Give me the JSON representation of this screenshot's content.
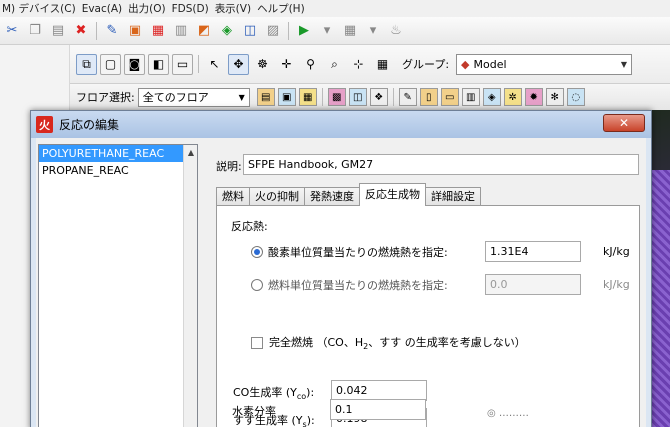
{
  "menubar": {
    "items": [
      "M) デバイス(C)",
      "Evac(A)",
      "出力(O)",
      "FDS(D)",
      "表示(V)",
      "ヘルプ(H)"
    ]
  },
  "toolbar2": {
    "group_label": "グループ:",
    "group_value": "Model"
  },
  "toolbar3": {
    "floor_label": "フロア選択:",
    "floor_value": "全てのフロア"
  },
  "dialog": {
    "title": "反応の編集",
    "close_glyph": "✕",
    "reactions": [
      "POLYURETHANE_REAC",
      "PROPANE_REAC"
    ],
    "selected_index": 0,
    "description_label": "説明:",
    "description_value": "SFPE Handbook, GM27",
    "tabs": [
      "燃料",
      "火の抑制",
      "発熱速度",
      "反応生成物",
      "詳細設定"
    ],
    "active_tab_index": 3,
    "heat": {
      "label": "反応熱:",
      "option_oxygen_label": "酸素単位質量当たりの燃焼熱を指定:",
      "option_oxygen_value": "1.31E4",
      "option_oxygen_unit": "kJ/kg",
      "option_fuel_label": "燃料単位質量当たりの燃焼熱を指定:",
      "option_fuel_value": "0.0",
      "option_fuel_unit": "kJ/kg",
      "selected": "oxygen"
    },
    "complete_combustion": {
      "label_prefix": "完全燃焼 （CO、H",
      "label_sub": "2",
      "label_suffix": "、すす の生成率を考慮しない）",
      "checked": false
    },
    "yields": {
      "co_label_prefix": "CO生成率 (Y",
      "co_label_sub": "co",
      "co_label_suffix": "):",
      "co_value": "0.042",
      "soot_label_prefix": "すす生成率 (Y",
      "soot_label_sub": "s",
      "soot_label_suffix": "):",
      "soot_value": "0.198",
      "hydrogen_label": "水素分率",
      "hydrogen_value": "0.1"
    }
  },
  "watermark": "◎ ………"
}
